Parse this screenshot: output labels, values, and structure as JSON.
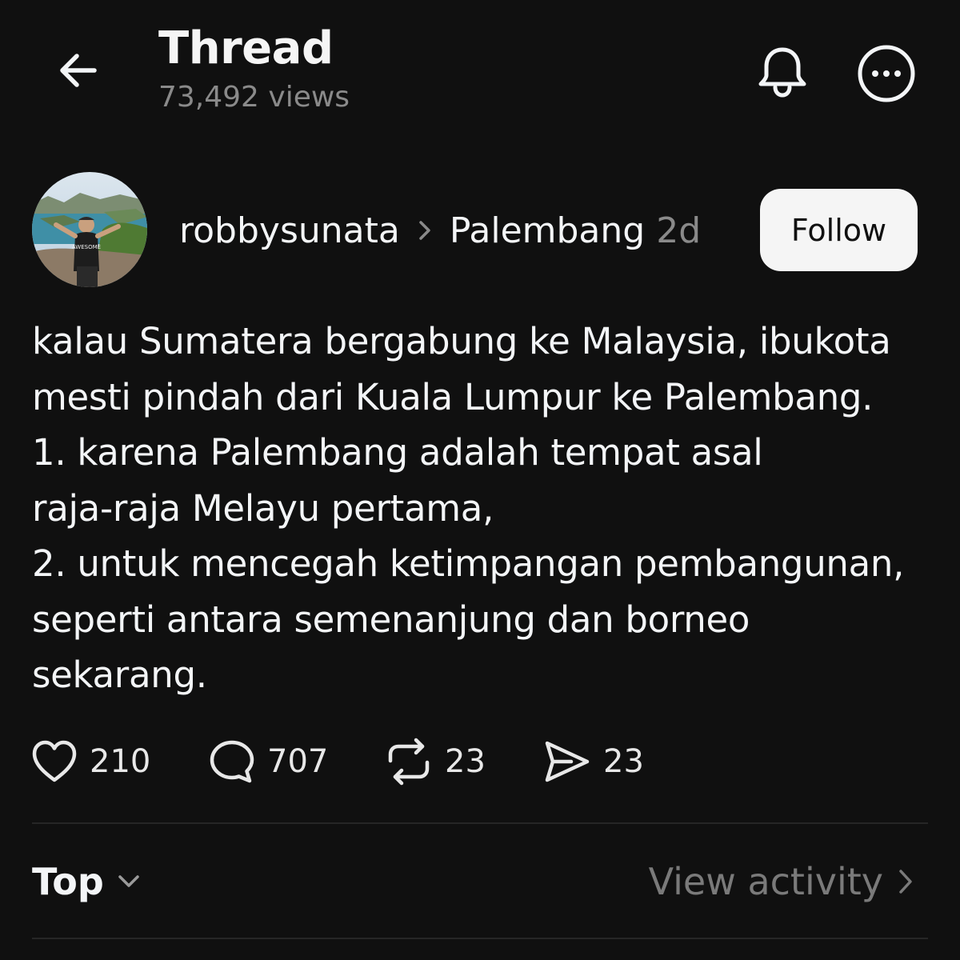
{
  "header": {
    "title": "Thread",
    "views": "73,492 views"
  },
  "post": {
    "author": "robbysunata",
    "topic": "Palembang",
    "time": "2d",
    "follow_label": "Follow",
    "lines": [
      "kalau Sumatera bergabung ke Malaysia, ibukota",
      "mesti pindah dari Kuala Lumpur ke Palembang.",
      "1. karena Palembang adalah tempat asal",
      "raja-raja Melayu pertama,",
      "2. untuk mencegah ketimpangan pembangunan,",
      "seperti antara semenanjung dan borneo",
      "sekarang."
    ],
    "avatar_shirt_text": "AWESOME",
    "stats": {
      "likes": "210",
      "replies": "707",
      "reposts": "23",
      "shares": "23"
    }
  },
  "footer": {
    "sort_label": "Top",
    "activity_label": "View activity"
  },
  "icons": {
    "back": "back-arrow-icon",
    "bell": "bell-icon",
    "more": "more-icon",
    "like": "heart-icon",
    "reply": "comment-icon",
    "repost": "repost-icon",
    "share": "send-icon"
  },
  "colors": {
    "background": "#101010",
    "text": "#f3f5f7",
    "muted": "#8a8a8a",
    "button_bg": "#f5f5f5"
  }
}
